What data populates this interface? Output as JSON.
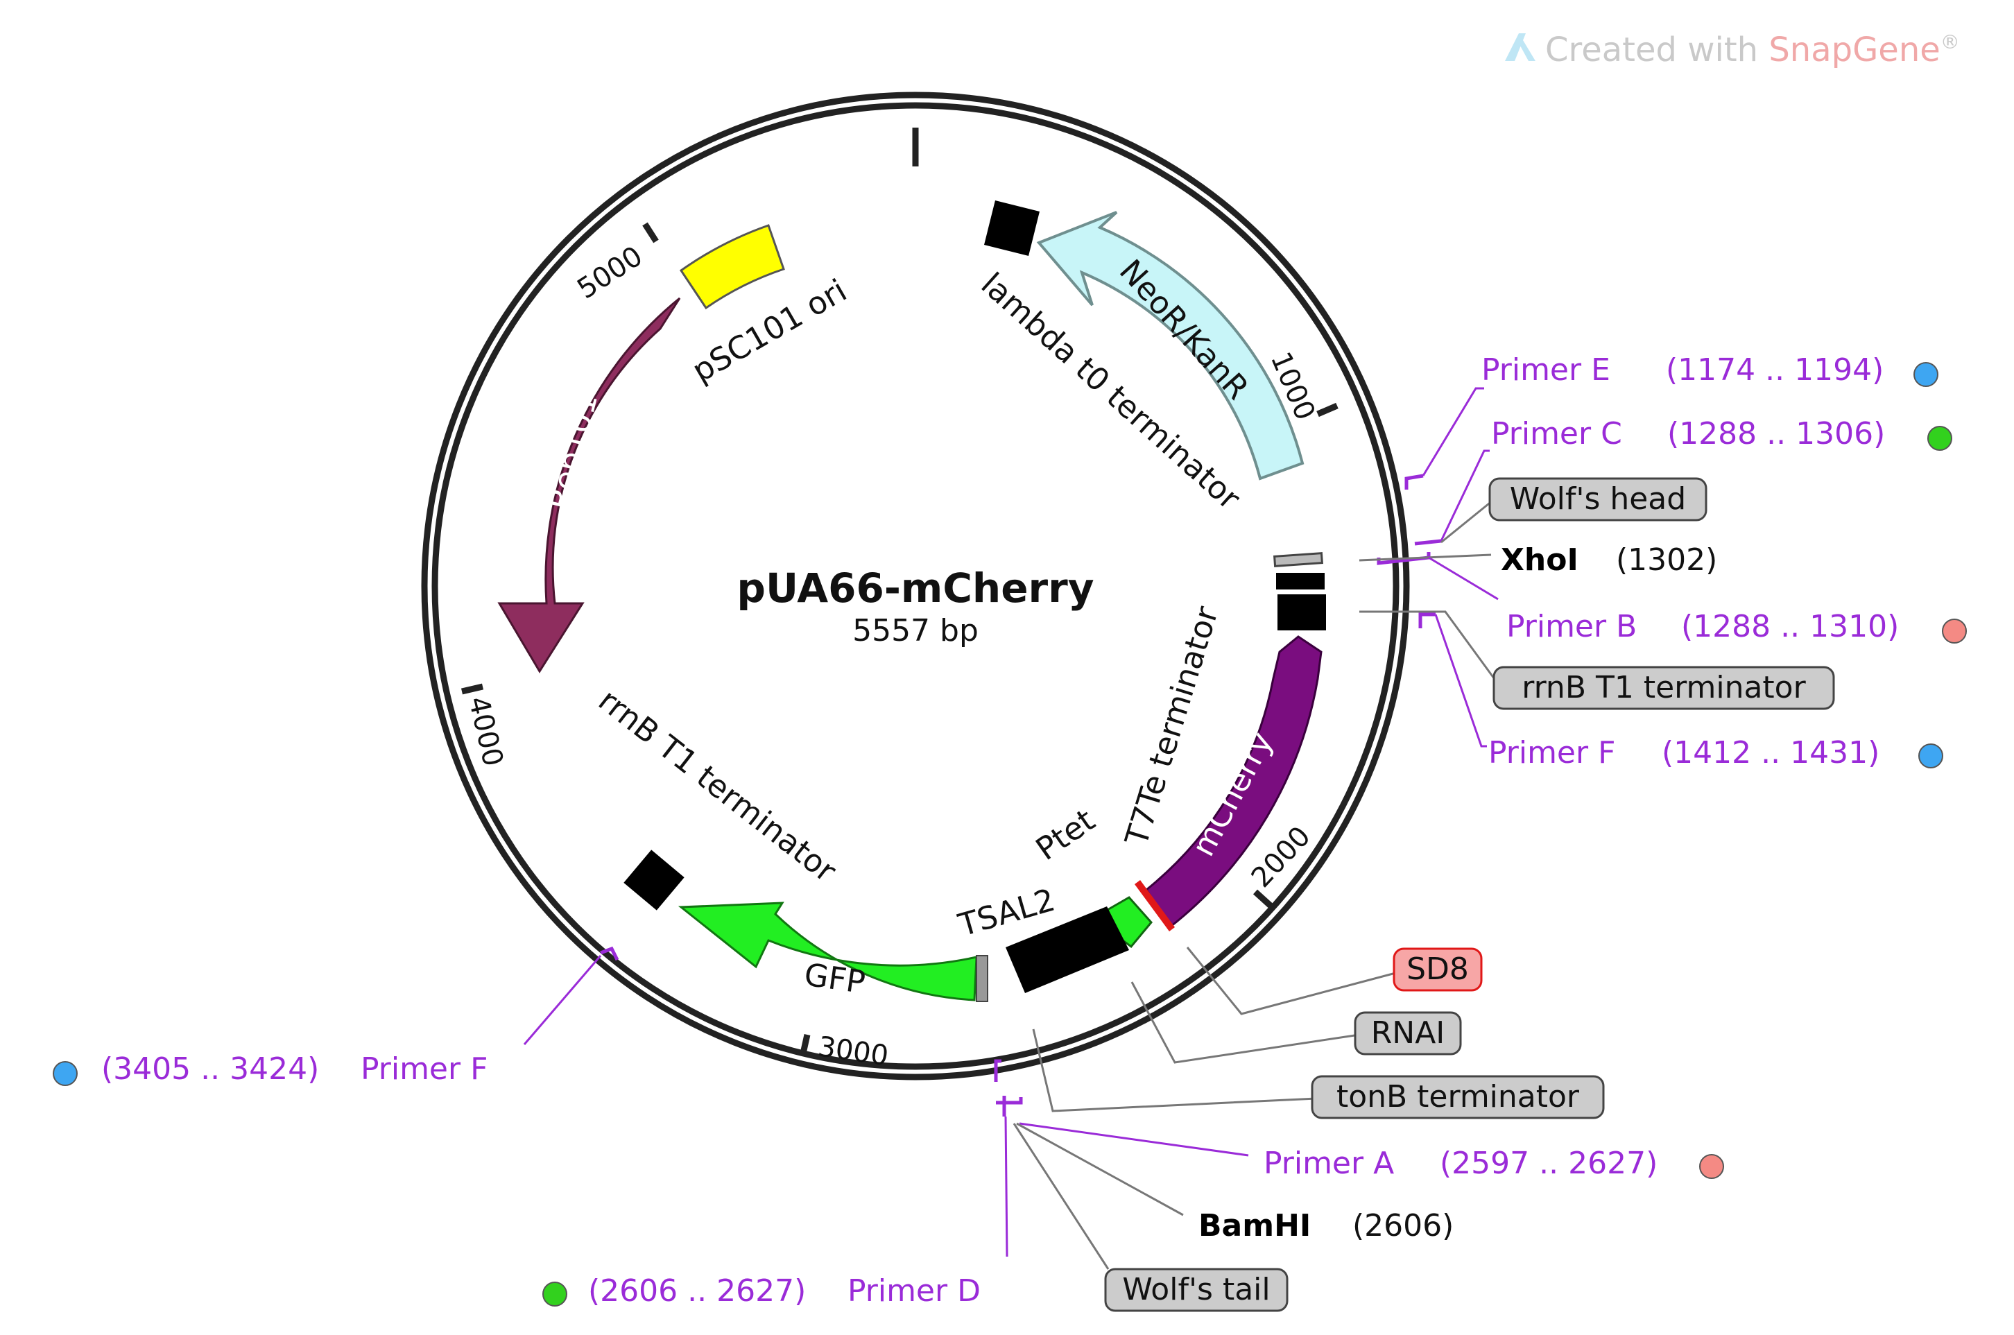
{
  "watermark": {
    "prefix": "Created with ",
    "brand": "SnapGene",
    "suffix": "®"
  },
  "plasmid": {
    "name": "pUA66-mCherry",
    "size_label": "5557 bp"
  },
  "ticks": [
    "1000",
    "2000",
    "3000",
    "4000",
    "5000"
  ],
  "features": {
    "neor": "NeoR/KanR",
    "mcherry": "mCherry",
    "gfp": "GFP",
    "rep101": "Rep101",
    "psc101": "pSC101 ori",
    "lambda": "lambda t0 terminator",
    "t7te": "T7Te terminator",
    "ptet": "Ptet",
    "tsal2": "TSAL2",
    "rrnb_inner": "rrnB T1 terminator"
  },
  "annotations": {
    "primer_e": {
      "name": "Primer E",
      "range": "(1174 .. 1194)",
      "color": "#3ea6f2"
    },
    "primer_c": {
      "name": "Primer C",
      "range": "(1288 .. 1306)",
      "color": "#32d11e"
    },
    "wolfs_head": "Wolf's head",
    "xhoi": {
      "name": "XhoI",
      "pos": "(1302)"
    },
    "primer_b": {
      "name": "Primer B",
      "range": "(1288 .. 1310)",
      "color": "#f48a84"
    },
    "rrnb_box": "rrnB T1 terminator",
    "primer_f_right": {
      "name": "Primer F",
      "range": "(1412 .. 1431)",
      "color": "#3ea6f2"
    },
    "sd8": "SD8",
    "rnai": "RNAI",
    "tonb": "tonB terminator",
    "primer_a": {
      "name": "Primer A",
      "range": "(2597 .. 2627)",
      "color": "#f48a84"
    },
    "bamhi": {
      "name": "BamHI",
      "pos": "(2606)"
    },
    "wolfs_tail": "Wolf's tail",
    "primer_d": {
      "name": "Primer D",
      "range": "(2606 .. 2627)",
      "color": "#32d11e"
    },
    "primer_f_left": {
      "name": "Primer F",
      "range": "(3405 .. 3424)",
      "color": "#3ea6f2"
    }
  },
  "colors": {
    "backbone": "#222222",
    "neor": "#c8f5f8",
    "mcherry": "#7a0d7f",
    "gfp": "#22ee22",
    "rep101": "#8e2d5e",
    "psc101": "#ffff00",
    "primer": "#9a2bd8",
    "red_box": "#f7a6a6",
    "grey_box": "#cccccc"
  }
}
